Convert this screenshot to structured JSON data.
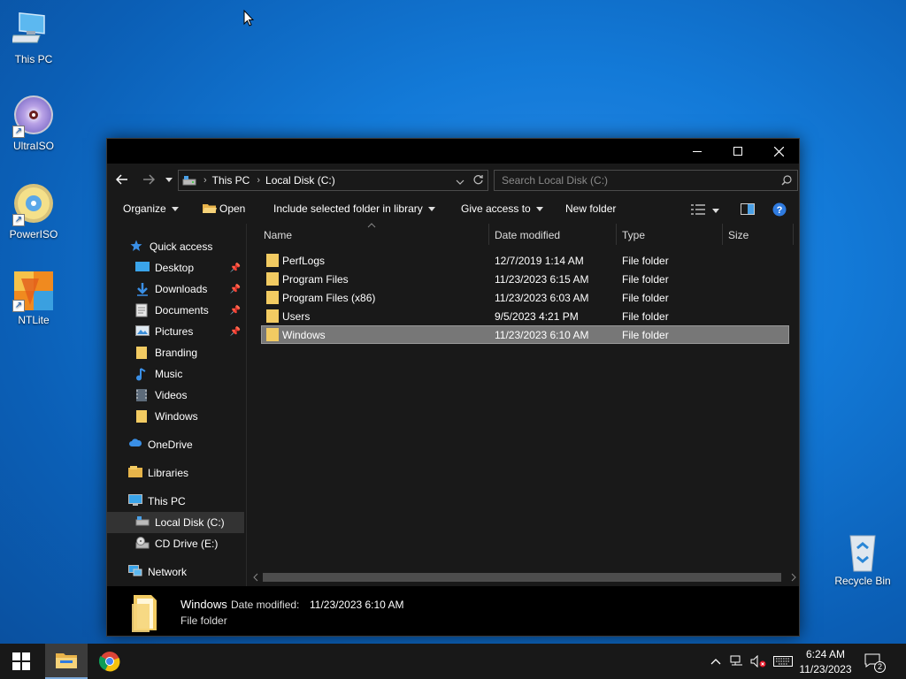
{
  "desktop": {
    "icons": [
      {
        "label": "This PC"
      },
      {
        "label": "UltraISO"
      },
      {
        "label": "PowerISO"
      },
      {
        "label": "NTLite"
      },
      {
        "label": "Recycle Bin"
      }
    ]
  },
  "window": {
    "address": {
      "crumbs": [
        "This PC",
        "Local Disk (C:)"
      ]
    },
    "search": {
      "placeholder": "Search Local Disk (C:)"
    },
    "command_bar": {
      "organize": "Organize",
      "open": "Open",
      "include": "Include selected folder in library",
      "give_access": "Give access to",
      "new_folder": "New folder"
    },
    "nav": {
      "quick_access": "Quick access",
      "desktop": "Desktop",
      "downloads": "Downloads",
      "documents": "Documents",
      "pictures": "Pictures",
      "branding": "Branding",
      "music": "Music",
      "videos": "Videos",
      "windows": "Windows",
      "onedrive": "OneDrive",
      "libraries": "Libraries",
      "this_pc": "This PC",
      "local_disk": "Local Disk (C:)",
      "cd_drive": "CD Drive (E:)",
      "network": "Network"
    },
    "columns": {
      "name": "Name",
      "date": "Date modified",
      "type": "Type",
      "size": "Size"
    },
    "rows": [
      {
        "name": "PerfLogs",
        "date": "12/7/2019 1:14 AM",
        "type": "File folder"
      },
      {
        "name": "Program Files",
        "date": "11/23/2023 6:15 AM",
        "type": "File folder"
      },
      {
        "name": "Program Files (x86)",
        "date": "11/23/2023 6:03 AM",
        "type": "File folder"
      },
      {
        "name": "Users",
        "date": "9/5/2023 4:21 PM",
        "type": "File folder"
      },
      {
        "name": "Windows",
        "date": "11/23/2023 6:10 AM",
        "type": "File folder"
      }
    ],
    "details": {
      "name": "Windows",
      "date_label": "Date modified:",
      "date_value": "11/23/2023 6:10 AM",
      "type": "File folder"
    }
  },
  "taskbar": {
    "time": "6:24 AM",
    "date": "11/23/2023",
    "notification_count": "2"
  }
}
